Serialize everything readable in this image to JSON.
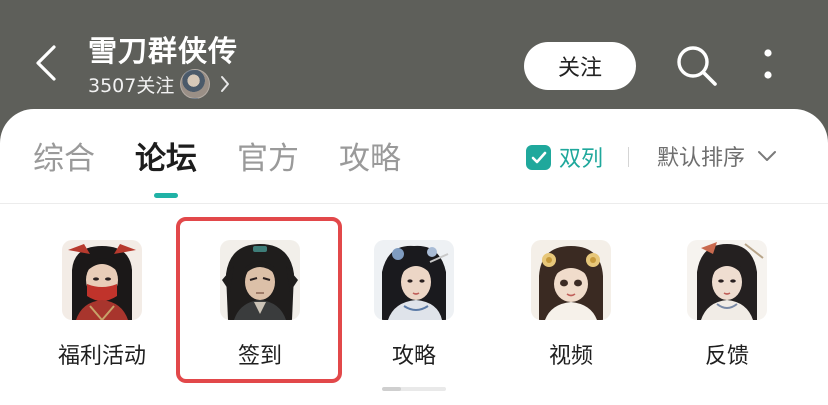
{
  "header": {
    "title": "雪刀群侠传",
    "follower_count": "3507关注",
    "follow_label": "关注",
    "icons": {
      "back": "chevron-left-icon",
      "search": "search-icon",
      "more": "more-vertical-icon",
      "subinfo_arrow": "chevron-right-icon"
    }
  },
  "tabs": [
    {
      "label": "综合",
      "active": false
    },
    {
      "label": "论坛",
      "active": true
    },
    {
      "label": "官方",
      "active": false
    },
    {
      "label": "攻略",
      "active": false
    }
  ],
  "view_toggle": {
    "label": "双列",
    "checked": true
  },
  "sort": {
    "selected": "默认排序"
  },
  "shortcuts": [
    {
      "label": "福利活动",
      "icon": "character-red-mask-icon"
    },
    {
      "label": "签到",
      "icon": "character-swordsman-icon"
    },
    {
      "label": "攻略",
      "icon": "character-lady-blue-icon"
    },
    {
      "label": "视频",
      "icon": "character-girl-flowers-icon"
    },
    {
      "label": "反馈",
      "icon": "character-lady-pale-icon"
    }
  ],
  "highlighted_shortcut": "签到",
  "scroll_progress": 0.3,
  "colors": {
    "header_bg": "#5e5f5a",
    "accent": "#1fa89c",
    "highlight_border": "#e2484a"
  }
}
